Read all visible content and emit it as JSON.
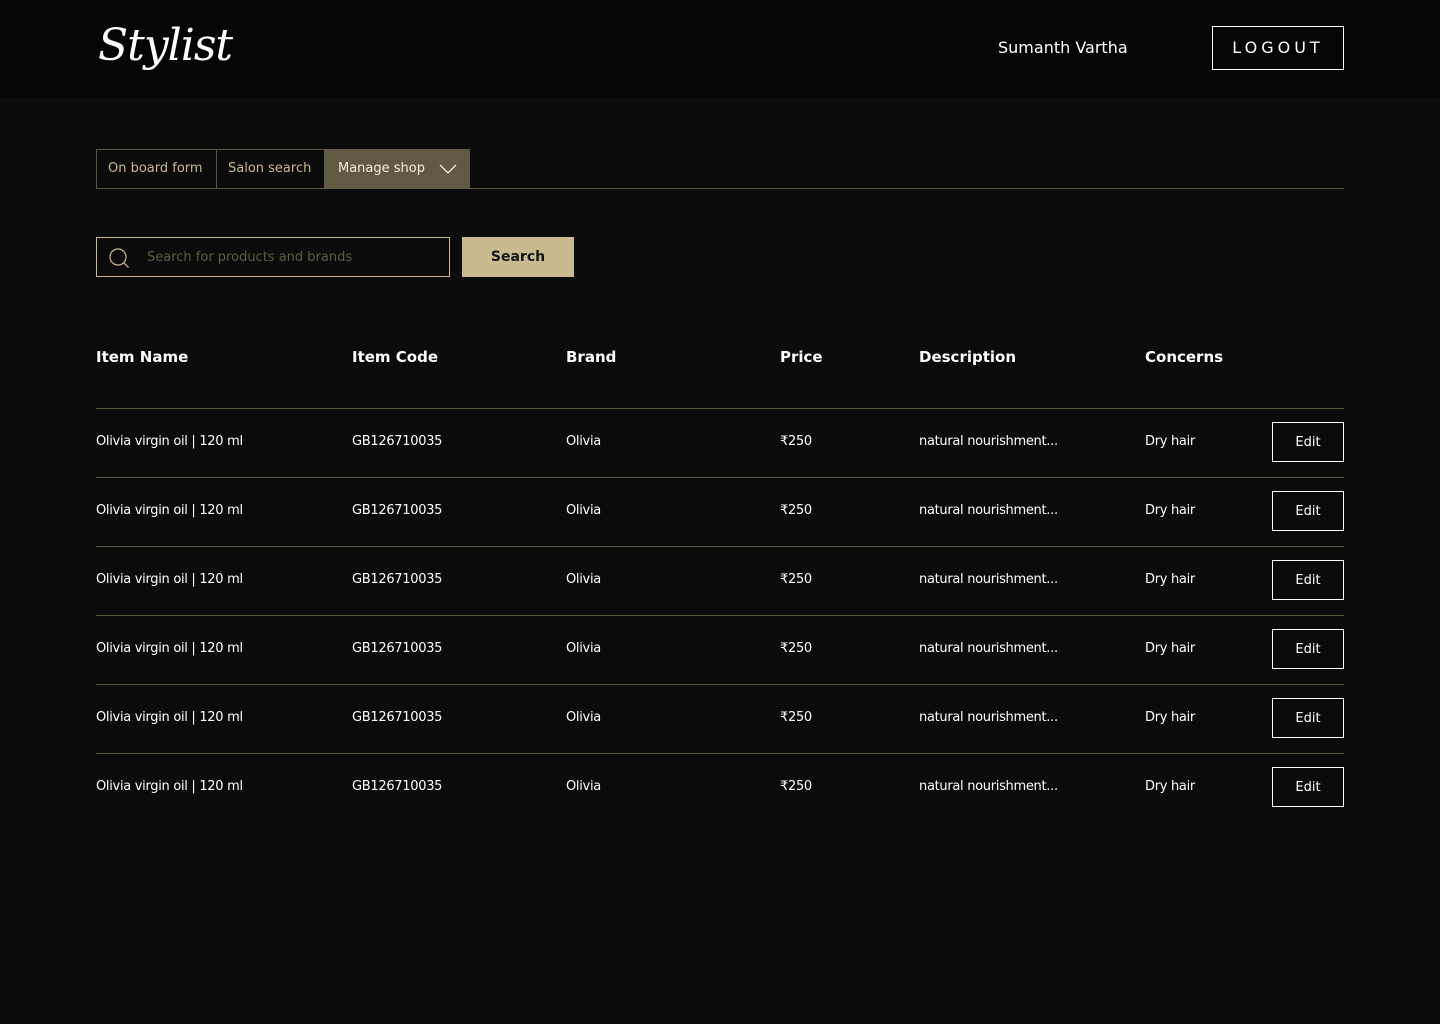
{
  "header": {
    "logo_text": "Stylist",
    "user_name": "Sumanth Vartha",
    "logout_label": "LOGOUT"
  },
  "tabs": [
    {
      "label": "On board form"
    },
    {
      "label": "Salon search"
    },
    {
      "label": "Manage shop",
      "active": true,
      "icon": "chevron-down-icon"
    }
  ],
  "search": {
    "placeholder": "Search for products and brands",
    "value": "",
    "button_label": "Search",
    "icon": "search-icon"
  },
  "table": {
    "columns": [
      "Item Name",
      "Item Code",
      "Brand",
      "Price",
      "Description",
      "Concerns"
    ],
    "rows": [
      {
        "name": "Olivia virgin oil | 120 ml",
        "code": "GB126710035",
        "brand": "Olivia",
        "price": "₹250",
        "description": "natural nourishment...",
        "concerns": "Dry hair",
        "action": "Edit"
      },
      {
        "name": "Olivia virgin oil | 120 ml",
        "code": "GB126710035",
        "brand": "Olivia",
        "price": "₹250",
        "description": "natural nourishment...",
        "concerns": "Dry hair",
        "action": "Edit"
      },
      {
        "name": "Olivia virgin oil | 120 ml",
        "code": "GB126710035",
        "brand": "Olivia",
        "price": "₹250",
        "description": "natural nourishment...",
        "concerns": "Dry hair",
        "action": "Edit"
      },
      {
        "name": "Olivia virgin oil | 120 ml",
        "code": "GB126710035",
        "brand": "Olivia",
        "price": "₹250",
        "description": "natural nourishment...",
        "concerns": "Dry hair",
        "action": "Edit"
      },
      {
        "name": "Olivia virgin oil | 120 ml",
        "code": "GB126710035",
        "brand": "Olivia",
        "price": "₹250",
        "description": "natural nourishment...",
        "concerns": "Dry hair",
        "action": "Edit"
      },
      {
        "name": "Olivia virgin oil | 120 ml",
        "code": "GB126710035",
        "brand": "Olivia",
        "price": "₹250",
        "description": "natural nourishment...",
        "concerns": "Dry hair",
        "action": "Edit"
      }
    ]
  },
  "colors": {
    "background": "#0b0b0b",
    "header_background": "#050505",
    "accent_gold": "#c9bb8f",
    "active_tab": "#5e5a44",
    "divider": "#5a5640"
  }
}
